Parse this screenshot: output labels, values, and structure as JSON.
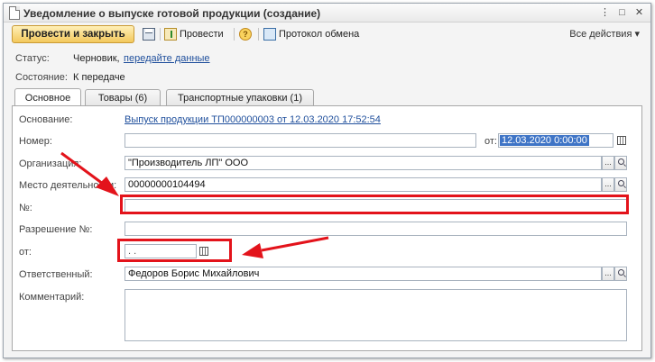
{
  "window": {
    "title": "Уведомление о выпуске готовой продукции (создание)"
  },
  "toolbar": {
    "post_close_label": "Провести и закрыть",
    "post_label": "Провести",
    "exchange_label": "Протокол обмена",
    "all_actions_label": "Все действия ▾"
  },
  "status": {
    "label": "Статус:",
    "value": "Черновик,",
    "link": "передайте данные"
  },
  "state": {
    "label": "Состояние:",
    "value": "К передаче"
  },
  "tabs": [
    {
      "label": "Основное",
      "active": true
    },
    {
      "label": "Товары (6)",
      "active": false
    },
    {
      "label": "Транспортные упаковки (1)",
      "active": false
    }
  ],
  "form": {
    "basis_label": "Основание:",
    "basis_link": "Выпуск продукции ТП000000003 от 12.03.2020 17:52:54",
    "number_label": "Номер:",
    "number_value": "",
    "date_label": "от:",
    "date_value": "12.03.2020  0:00:00",
    "org_label": "Организация:",
    "org_value": "\"Производитель ЛП\" ООО",
    "place_label": "Место деятельности:",
    "place_value": "00000000104494",
    "no_label": "№:",
    "no_value": "",
    "permit_label": "Разрешение №:",
    "permit_value": "",
    "permit_date_label": "от:",
    "permit_date_value": ". .",
    "resp_label": "Ответственный:",
    "resp_value": "Федоров Борис Михайлович",
    "comment_label": "Комментарий:",
    "comment_value": ""
  },
  "colors": {
    "accent_button": "#f3c85c",
    "annotation_red": "#e3131b",
    "link": "#1f4f9c",
    "selection": "#3e74c6"
  }
}
